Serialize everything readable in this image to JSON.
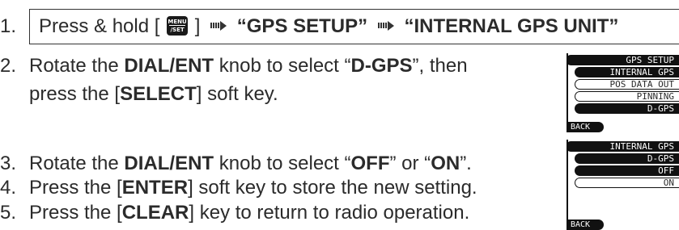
{
  "step1": {
    "num": "1.",
    "prefix": "Press & hold [",
    "key_top": "MENU",
    "key_bottom": "/SET",
    "suffix": "]",
    "item1": "“GPS SETUP”",
    "item2": "“INTERNAL GPS UNIT”"
  },
  "step2": {
    "num": "2.",
    "t1": "Rotate the ",
    "b1": "DIAL/ENT",
    "t2": " knob to select “",
    "b2": "D-GPS",
    "t3": "”, then",
    "t4": "press the [",
    "b3": "SELECT",
    "t5": "] soft key."
  },
  "step3": {
    "num": "3.",
    "t1": "Rotate the ",
    "b1": "DIAL/ENT",
    "t2": " knob to select “",
    "b2": "OFF",
    "t3": "” or “",
    "b3": "ON",
    "t4": "”."
  },
  "step4": {
    "num": "4.",
    "t1": "Press the [",
    "b1": "ENTER",
    "t2": "] soft key to store the new setting."
  },
  "step5": {
    "num": "5.",
    "t1": "Press the [",
    "b1": "CLEAR",
    "t2": "] key to return to radio operation."
  },
  "lcd1": {
    "title": "GPS SETUP",
    "items": [
      "INTERNAL GPS",
      "POS DATA OUT",
      "PINNING",
      "D-GPS"
    ],
    "back": "BACK"
  },
  "lcd2": {
    "title": "INTERNAL GPS",
    "subtitle": "D-GPS",
    "items": [
      "OFF",
      "ON"
    ],
    "back": "BACK"
  }
}
